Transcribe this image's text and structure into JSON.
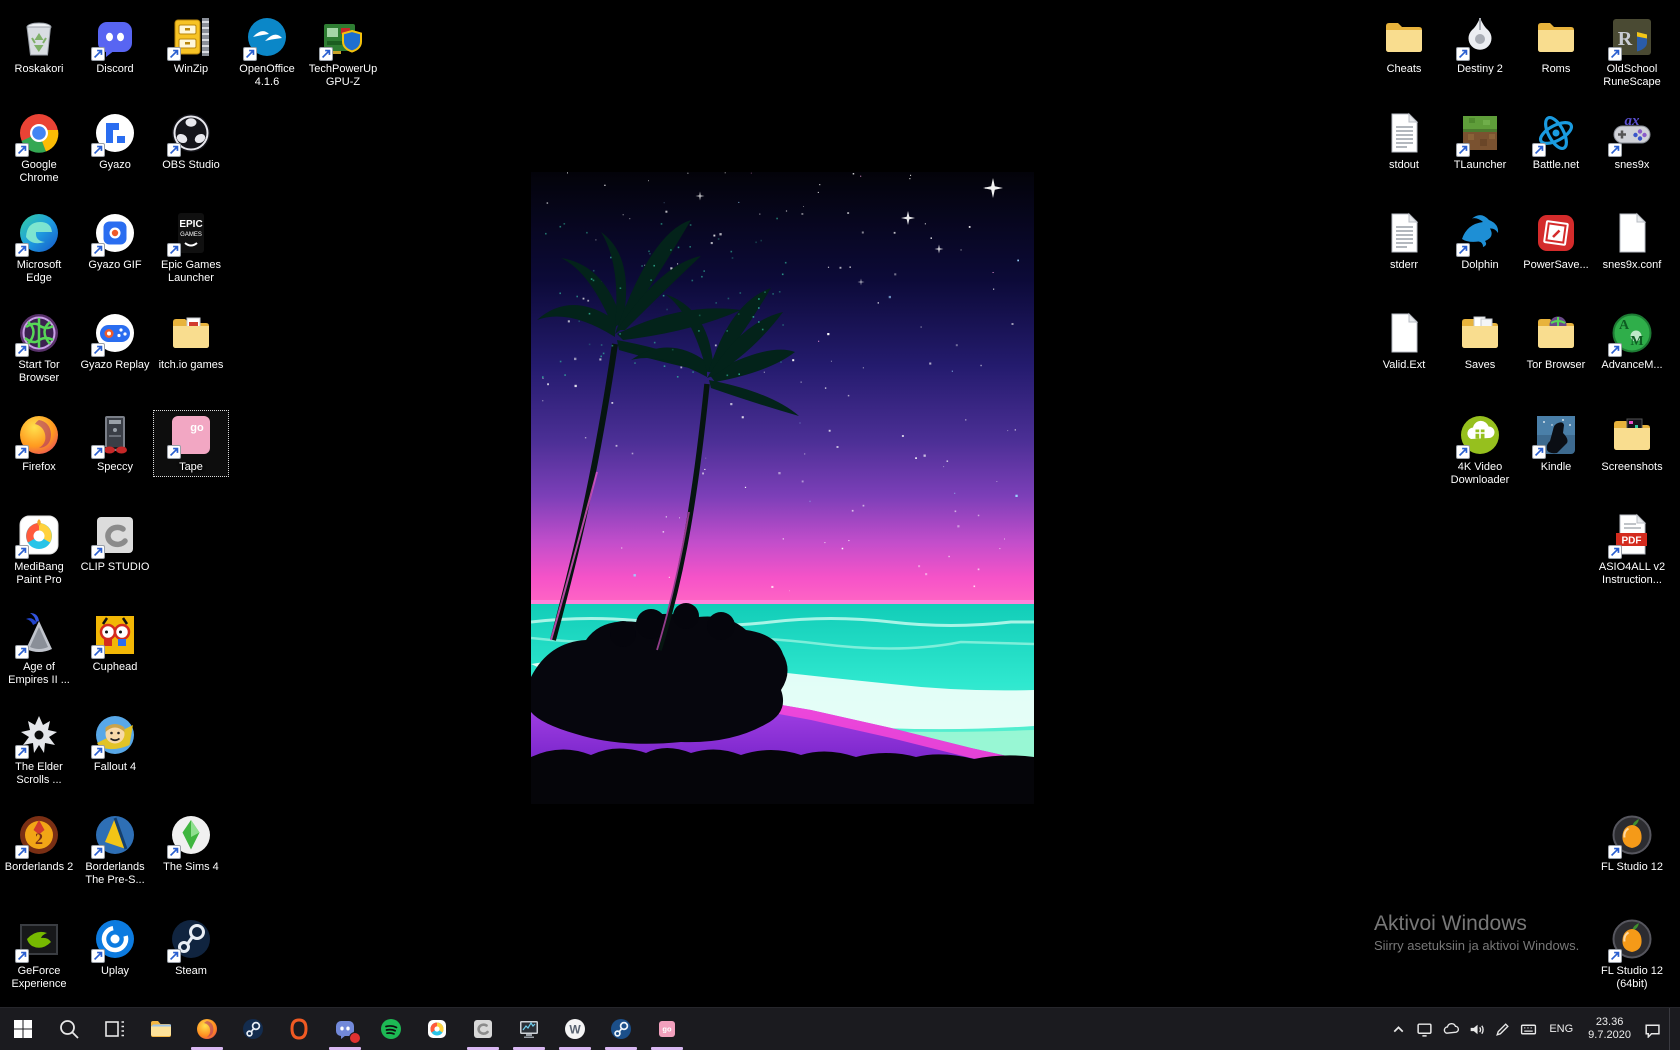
{
  "desktop": {
    "left_icons": [
      {
        "label": "Roskakori",
        "art": "recycle",
        "col": 0,
        "row": 0,
        "arrow": false
      },
      {
        "label": "Discord",
        "art": "discord",
        "col": 1,
        "row": 0,
        "arrow": true
      },
      {
        "label": "WinZip",
        "art": "winzip",
        "col": 2,
        "row": 0,
        "arrow": true
      },
      {
        "label": "OpenOffice\n4.1.6",
        "art": "openoffice",
        "col": 3,
        "row": 0,
        "arrow": true
      },
      {
        "label": "TechPowerUp\nGPU-Z",
        "art": "gpuz",
        "col": 4,
        "row": 0,
        "arrow": true
      },
      {
        "label": "Google\nChrome",
        "art": "chrome",
        "col": 0,
        "row": 1,
        "arrow": true
      },
      {
        "label": "Gyazo",
        "art": "gyazo",
        "col": 1,
        "row": 1,
        "arrow": true
      },
      {
        "label": "OBS Studio",
        "art": "obs",
        "col": 2,
        "row": 1,
        "arrow": true
      },
      {
        "label": "Microsoft\nEdge",
        "art": "edge",
        "col": 0,
        "row": 2,
        "arrow": true
      },
      {
        "label": "Gyazo GIF",
        "art": "gyazogif",
        "col": 1,
        "row": 2,
        "arrow": true
      },
      {
        "label": "Epic Games\nLauncher",
        "art": "epic",
        "col": 2,
        "row": 2,
        "arrow": true
      },
      {
        "label": "Start Tor\nBrowser",
        "art": "torglobe",
        "col": 0,
        "row": 3,
        "arrow": true
      },
      {
        "label": "Gyazo Replay",
        "art": "gyazoreplay",
        "col": 1,
        "row": 3,
        "arrow": true
      },
      {
        "label": "itch.io games",
        "art": "folder_pdf",
        "col": 2,
        "row": 3,
        "arrow": false
      },
      {
        "label": "Firefox",
        "art": "firefox",
        "col": 0,
        "row": 4,
        "arrow": true
      },
      {
        "label": "Speccy",
        "art": "speccy",
        "col": 1,
        "row": 4,
        "arrow": true
      },
      {
        "label": "Tape",
        "art": "tape",
        "col": 2,
        "row": 4,
        "arrow": true,
        "selected": true
      },
      {
        "label": "MediBang\nPaint Pro",
        "art": "medibang",
        "col": 0,
        "row": 5,
        "arrow": true
      },
      {
        "label": "CLIP STUDIO",
        "art": "clipstudio",
        "col": 1,
        "row": 5,
        "arrow": true
      },
      {
        "label": "Age of\nEmpires II ...",
        "art": "aoe2",
        "col": 0,
        "row": 6,
        "arrow": true
      },
      {
        "label": "Cuphead",
        "art": "cuphead",
        "col": 1,
        "row": 6,
        "arrow": true
      },
      {
        "label": "The Elder\nScrolls ...",
        "art": "skyrim",
        "col": 0,
        "row": 7,
        "arrow": true
      },
      {
        "label": "Fallout 4",
        "art": "fallout",
        "col": 1,
        "row": 7,
        "arrow": true
      },
      {
        "label": "Borderlands 2",
        "art": "bl2",
        "col": 0,
        "row": 8,
        "arrow": true
      },
      {
        "label": "Borderlands\nThe Pre-S...",
        "art": "blps",
        "col": 1,
        "row": 8,
        "arrow": true
      },
      {
        "label": "The Sims 4",
        "art": "sims4",
        "col": 2,
        "row": 8,
        "arrow": true
      },
      {
        "label": "GeForce\nExperience",
        "art": "geforce",
        "col": 0,
        "row": 9,
        "arrow": true
      },
      {
        "label": "Uplay",
        "art": "uplay",
        "col": 1,
        "row": 9,
        "arrow": true
      },
      {
        "label": "Steam",
        "art": "steam",
        "col": 2,
        "row": 9,
        "arrow": true
      }
    ],
    "right_icons": [
      {
        "label": "Cheats",
        "art": "folder",
        "col": 0,
        "row": 0,
        "arrow": false
      },
      {
        "label": "Destiny 2",
        "art": "destiny",
        "col": 1,
        "row": 0,
        "arrow": true
      },
      {
        "label": "Roms",
        "art": "folder",
        "col": 2,
        "row": 0,
        "arrow": false
      },
      {
        "label": "OldSchool\nRuneScape",
        "art": "osrs",
        "col": 3,
        "row": 0,
        "arrow": true
      },
      {
        "label": "stdout",
        "art": "doc_lines",
        "col": 0,
        "row": 1,
        "arrow": false
      },
      {
        "label": "TLauncher",
        "art": "tlauncher",
        "col": 1,
        "row": 1,
        "arrow": true
      },
      {
        "label": "Battle.net",
        "art": "battlenet",
        "col": 2,
        "row": 1,
        "arrow": true
      },
      {
        "label": "snes9x",
        "art": "snes9x",
        "col": 3,
        "row": 1,
        "arrow": true
      },
      {
        "label": "stderr",
        "art": "doc_lines",
        "col": 0,
        "row": 2,
        "arrow": false
      },
      {
        "label": "Dolphin",
        "art": "dolphin",
        "col": 1,
        "row": 2,
        "arrow": true
      },
      {
        "label": "PowerSave...",
        "art": "powersave",
        "col": 2,
        "row": 2,
        "arrow": false
      },
      {
        "label": "snes9x.conf",
        "art": "doc_blank",
        "col": 3,
        "row": 2,
        "arrow": false
      },
      {
        "label": "Valid.Ext",
        "art": "doc_blank",
        "col": 0,
        "row": 3,
        "arrow": false
      },
      {
        "label": "Saves",
        "art": "folder_docs",
        "col": 1,
        "row": 3,
        "arrow": false
      },
      {
        "label": "Tor Browser",
        "art": "folder_globe",
        "col": 2,
        "row": 3,
        "arrow": false
      },
      {
        "label": "AdvanceM...",
        "art": "advancem",
        "col": 3,
        "row": 3,
        "arrow": true
      },
      {
        "label": "4K Video\nDownloader",
        "art": "fourk",
        "col": 1,
        "row": 4,
        "arrow": true
      },
      {
        "label": "Kindle",
        "art": "kindle",
        "col": 2,
        "row": 4,
        "arrow": true
      },
      {
        "label": "Screenshots",
        "art": "folder_shot",
        "col": 3,
        "row": 4,
        "arrow": false
      },
      {
        "label": "ASIO4ALL v2\nInstruction...",
        "art": "pdf",
        "col": 3,
        "row": 5,
        "arrow": true
      },
      {
        "label": "FL Studio 12",
        "art": "flstudio",
        "col": 3,
        "row": 8,
        "arrow": true
      },
      {
        "label": "FL Studio 12\n(64bit)",
        "art": "flstudio",
        "col": 3,
        "row": 9,
        "arrow": true
      }
    ]
  },
  "watermark": {
    "title": "Aktivoi Windows",
    "subtitle": "Siirry asetuksiin ja aktivoi Windows."
  },
  "taskbar": {
    "buttons": [
      {
        "name": "start",
        "running": false
      },
      {
        "name": "search",
        "running": false
      },
      {
        "name": "task-view",
        "running": false
      },
      {
        "name": "file-explorer",
        "running": false
      },
      {
        "name": "firefox",
        "running": true
      },
      {
        "name": "steam",
        "running": false
      },
      {
        "name": "origin",
        "running": false
      },
      {
        "name": "discord",
        "running": true,
        "badge": true
      },
      {
        "name": "spotify",
        "running": false
      },
      {
        "name": "medibang",
        "running": false
      },
      {
        "name": "clip-studio",
        "running": true
      },
      {
        "name": "speccy-monitor",
        "running": true
      },
      {
        "name": "wattpad",
        "running": true
      },
      {
        "name": "steam-game",
        "running": true
      },
      {
        "name": "tape",
        "running": true
      }
    ],
    "tray": {
      "language": "ENG",
      "time": "23.36",
      "date": "9.7.2020"
    }
  },
  "accent_colors": {
    "running_underline": "#d9b8f2",
    "badge_red": "#e03131",
    "taskbar_bg": "#1b1b1f",
    "wallpaper_sky_top": "#030309",
    "wallpaper_pink": "#ff5ec2",
    "wallpaper_teal": "#2fe8cf",
    "wallpaper_sand_purple": "#8a2be2"
  }
}
